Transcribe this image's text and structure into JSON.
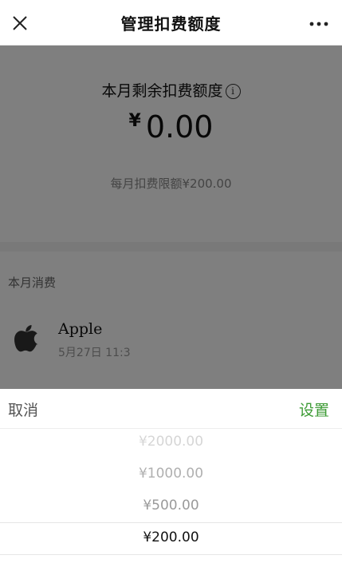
{
  "header": {
    "title": "管理扣费额度",
    "close_icon": "close-icon",
    "more_icon": "more-dots-icon"
  },
  "balance": {
    "label": "本月剩余扣费额度",
    "info_glyph": "i",
    "currency": "¥",
    "amount": "0.00",
    "limit_text": "每月扣费限额¥200.00"
  },
  "section": {
    "label": "本月消费",
    "items": [
      {
        "name": "Apple",
        "date": "5月27日 11:3",
        "icon": "apple-icon"
      }
    ]
  },
  "sheet": {
    "cancel_label": "取消",
    "confirm_label": "设置",
    "confirm_color": "#3d9b35",
    "options": [
      "¥2000.00",
      "¥1000.00",
      "¥500.00",
      "¥200.00"
    ],
    "selected": "¥200.00"
  }
}
